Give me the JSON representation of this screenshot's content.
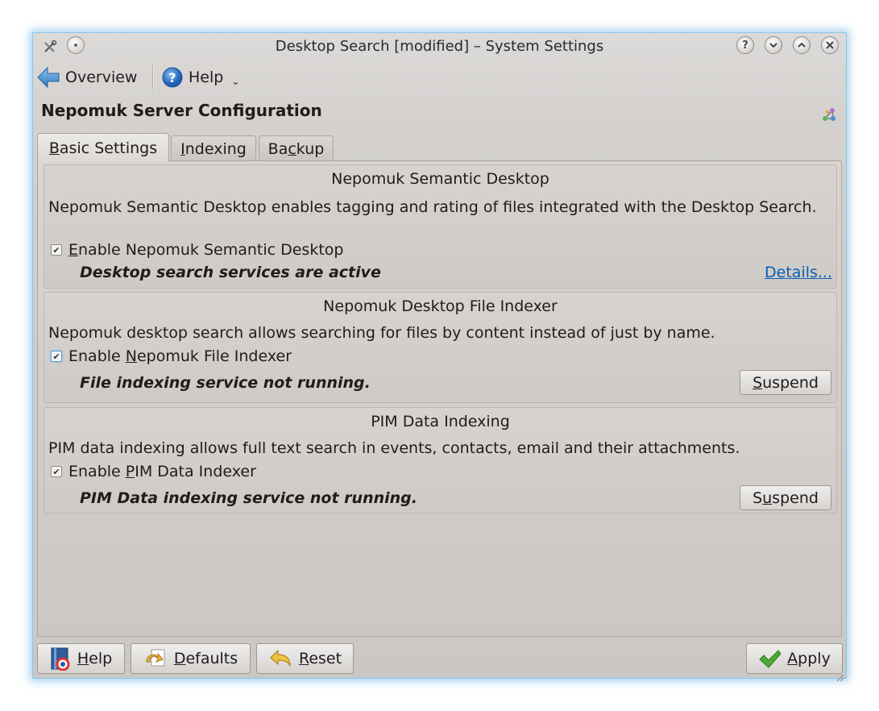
{
  "window": {
    "title": "Desktop Search [modified] – System Settings"
  },
  "toolbar": {
    "overview_label": "Overview",
    "help_label": "Help"
  },
  "page": {
    "title": "Nepomuk Server Configuration"
  },
  "tabs": [
    {
      "label_pre": "",
      "label_u": "B",
      "label_post": "asic Settings",
      "active": true
    },
    {
      "label_pre": "",
      "label_u": "I",
      "label_post": "ndexing",
      "active": false
    },
    {
      "label_pre": "Ba",
      "label_u": "c",
      "label_post": "kup",
      "active": false
    }
  ],
  "semantic": {
    "title": "Nepomuk Semantic Desktop",
    "description": "Nepomuk Semantic Desktop enables tagging and rating of files integrated with the Desktop Search.",
    "checkbox_u": "E",
    "checkbox_rest": "nable Nepomuk Semantic Desktop",
    "checked": true,
    "status": "Desktop search services are active",
    "details_link": "Details..."
  },
  "indexer": {
    "title": "Nepomuk Desktop File Indexer",
    "description": "Nepomuk desktop search allows searching for files by content instead of just by name.",
    "checkbox_pre": "Enable ",
    "checkbox_u": "N",
    "checkbox_rest": "epomuk File Indexer",
    "checked": true,
    "status": "File indexing service not running.",
    "suspend_u": "S",
    "suspend_rest": "uspend"
  },
  "pim": {
    "title": "PIM Data Indexing",
    "description": "PIM data indexing allows full text search in events, contacts, email and their attachments.",
    "checkbox_pre": "Enable ",
    "checkbox_u": "P",
    "checkbox_rest": "IM Data Indexer",
    "checked": true,
    "status": "PIM Data indexing service not running.",
    "suspend_pre": "S",
    "suspend_u": "u",
    "suspend_rest": "spend"
  },
  "buttons": {
    "help_u": "H",
    "help_rest": "elp",
    "defaults_u": "D",
    "defaults_rest": "efaults",
    "reset_u": "R",
    "reset_rest": "eset",
    "apply_u": "A",
    "apply_rest": "pply"
  },
  "colors": {
    "accent": "#4fa3dc",
    "link": "#0b5db3",
    "window_glow": "#8cc6ea"
  }
}
